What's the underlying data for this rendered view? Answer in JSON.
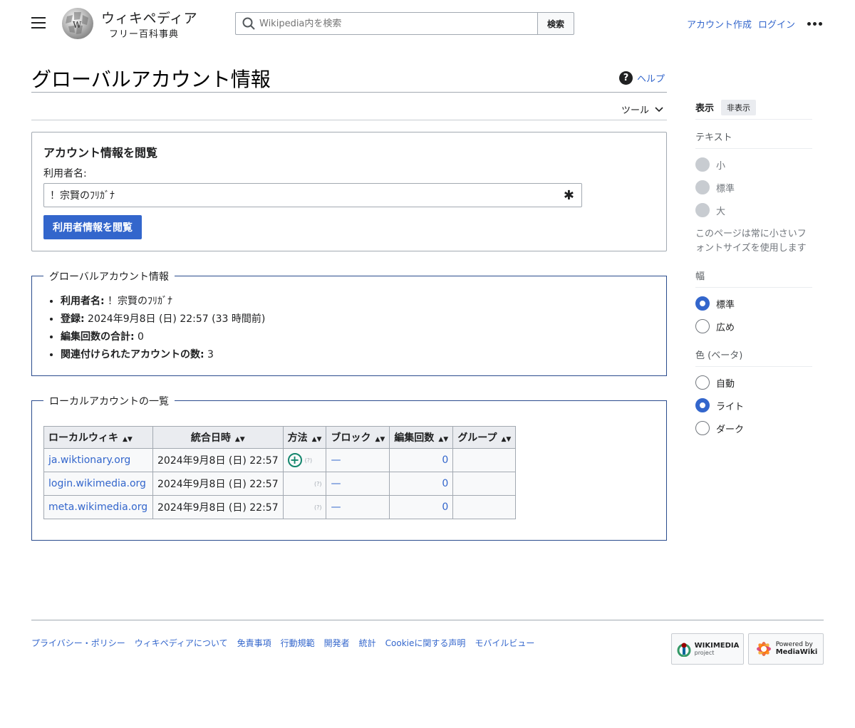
{
  "header": {
    "wordmark": "ウィキペディア",
    "tagline": "フリー百科事典",
    "search_placeholder": "Wikipedia内を検索",
    "search_button": "検索",
    "create_account": "アカウント作成",
    "login": "ログイン"
  },
  "page": {
    "title": "グローバルアカウント情報",
    "help": "ヘルプ",
    "tools": "ツール"
  },
  "form": {
    "title": "アカウント情報を閲覧",
    "label": "利用者名:",
    "value": "！宗賢のﾌﾘｶﾞﾅ",
    "submit": "利用者情報を閲覧"
  },
  "info": {
    "legend": "グローバルアカウント情報",
    "items": [
      {
        "label": "利用者名:",
        "value": " ！宗賢のﾌﾘｶﾞﾅ"
      },
      {
        "label": "登録:",
        "value": " 2024年9月8日 (日) 22:57 (33 時間前)"
      },
      {
        "label": "編集回数の合計:",
        "value": " 0"
      },
      {
        "label": "関連付けられたアカウントの数:",
        "value": " 3"
      }
    ]
  },
  "local": {
    "legend": "ローカルアカウントの一覧",
    "headers": [
      "ローカルウィキ",
      "統合日時",
      "方法",
      "ブロック",
      "編集回数",
      "グループ"
    ],
    "rows": [
      {
        "wiki": "ja.wiktionary.org",
        "date": "2024年9月8日 (日) 22:57",
        "method_q": "(?)",
        "block": "—",
        "edits": "0",
        "groups": ""
      },
      {
        "wiki": "login.wikimedia.org",
        "date": "2024年9月8日 (日) 22:57",
        "method_q": "(?)",
        "block": "—",
        "edits": "0",
        "groups": ""
      },
      {
        "wiki": "meta.wikimedia.org",
        "date": "2024年9月8日 (日) 22:57",
        "method_q": "(?)",
        "block": "—",
        "edits": "0",
        "groups": ""
      }
    ]
  },
  "sidebar": {
    "tab_show": "表示",
    "tab_hide": "非表示",
    "text_heading": "テキスト",
    "text_options": [
      "小",
      "標準",
      "大"
    ],
    "text_note": "このページは常に小さいフォントサイズを使用します",
    "width_heading": "幅",
    "width_options": [
      "標準",
      "広め"
    ],
    "color_heading": "色 (ベータ)",
    "color_options": [
      "自動",
      "ライト",
      "ダーク"
    ]
  },
  "footer": {
    "links": [
      "プライバシー・ポリシー",
      "ウィキペディアについて",
      "免責事項",
      "行動規範",
      "開発者",
      "統計",
      "Cookieに関する声明",
      "モバイルビュー"
    ],
    "wikimedia_top": "WIKIMEDIA",
    "wikimedia_sub": "project",
    "mediawiki_top": "Powered by",
    "mediawiki_sub": "MediaWiki"
  },
  "colors": {
    "link": "#3366cc",
    "accent": "#3366cc",
    "border": "#a2a9b1"
  }
}
